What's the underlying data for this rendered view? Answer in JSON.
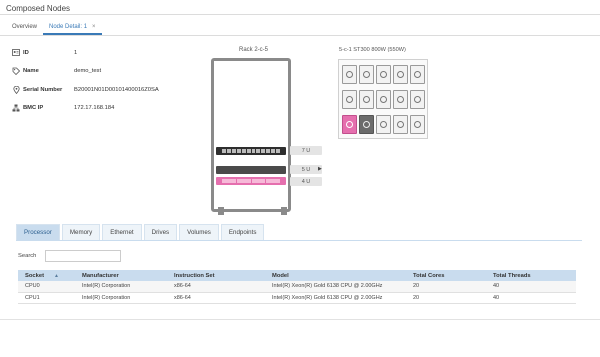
{
  "page": {
    "title": "Composed Nodes"
  },
  "top_tabs": [
    {
      "label": "Overview"
    },
    {
      "label": "Node Detail: 1",
      "close": "×"
    }
  ],
  "info": {
    "id": {
      "label": "ID",
      "value": "1",
      "icon": "id-card-icon"
    },
    "name": {
      "label": "Name",
      "value": "demo_test",
      "icon": "tag-icon"
    },
    "serial": {
      "label": "Serial Number",
      "value": "B20001N01D00101400016Z0SA",
      "icon": "location-pin-icon"
    },
    "bmc": {
      "label": "BMC IP",
      "value": "172.17.168.184",
      "icon": "network-icon"
    }
  },
  "rack": {
    "label": "Rack 2-c-5",
    "units": [
      {
        "label": "7 U"
      },
      {
        "label": "5 U"
      },
      {
        "label": "4 U"
      }
    ]
  },
  "chassis": {
    "label": "5-c-1 ST300 800W (550W)",
    "bays_per_row": 5,
    "rows": 3,
    "highlight": {
      "row": 3,
      "pink_index": 1,
      "dark_index": 2
    }
  },
  "bottom_tabs": [
    {
      "label": "Processor"
    },
    {
      "label": "Memory"
    },
    {
      "label": "Ethernet"
    },
    {
      "label": "Drives"
    },
    {
      "label": "Volumes"
    },
    {
      "label": "Endpoints"
    }
  ],
  "search": {
    "label": "Search",
    "placeholder": ""
  },
  "table": {
    "columns": [
      "Socket",
      "Manufacturer",
      "Instruction Set",
      "Model",
      "Total Cores",
      "Total Threads"
    ],
    "rows": [
      [
        "CPU0",
        "Intel(R) Corporation",
        "x86-64",
        "Intel(R) Xeon(R) Gold 6138 CPU @ 2.00GHz",
        "20",
        "40"
      ],
      [
        "CPU1",
        "Intel(R) Corporation",
        "x86-64",
        "Intel(R) Xeon(R) Gold 6138 CPU @ 2.00GHz",
        "20",
        "40"
      ]
    ]
  },
  "colors": {
    "accent": "#3a7ab7",
    "tab_active": "#c9dcee",
    "pink": "#e56fae"
  }
}
